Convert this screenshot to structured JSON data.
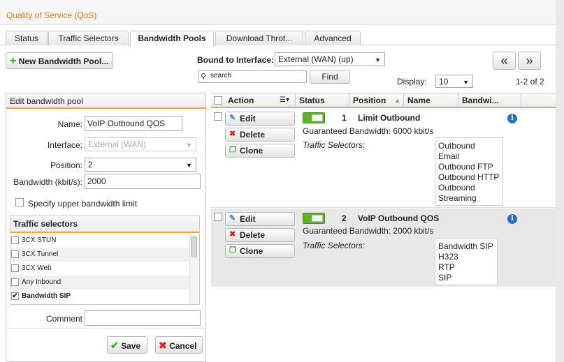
{
  "title": "Quality of Service (QoS)",
  "tabs": [
    {
      "label": "Status"
    },
    {
      "label": "Traffic Selectors"
    },
    {
      "label": "Bandwidth Pools"
    },
    {
      "label": "Download Throt..."
    },
    {
      "label": "Advanced"
    }
  ],
  "toolbar": {
    "new_pool": "New Bandwidth Pool...",
    "bound_label": "Bound to Interface:",
    "bound_value": "External (WAN) (up)",
    "search_placeholder": "search",
    "find": "Find",
    "display_label": "Display:",
    "display_value": "10",
    "pager_prev": "«",
    "pager_next": "»",
    "count": "1-2 of 2"
  },
  "edit_panel": {
    "title": "Edit bandwidth pool",
    "name_label": "Name:",
    "name_value": "VoIP Outbound QOS",
    "interface_label": "Interface:",
    "interface_value": "External (WAN)",
    "position_label": "Position:",
    "position_value": "2",
    "bandwidth_label": "Bandwidth (kbit/s):",
    "bandwidth_value": "2000",
    "upper_limit_label": "Specify upper bandwidth limit",
    "traffic_selectors_title": "Traffic selectors",
    "selectors": [
      {
        "label": "3CX STUN",
        "checked": false
      },
      {
        "label": "3CX Tunnel",
        "checked": false
      },
      {
        "label": "3CX Web",
        "checked": false
      },
      {
        "label": "Any Inbound",
        "checked": false
      },
      {
        "label": "Bandwidth SIP",
        "checked": true
      }
    ],
    "comment_label": "Comment",
    "comment_value": "",
    "save": "Save",
    "cancel": "Cancel"
  },
  "grid": {
    "columns": [
      "Action",
      "Status",
      "Position",
      "Name",
      "Bandwi..."
    ],
    "actions": {
      "edit": "Edit",
      "delete": "Delete",
      "clone": "Clone"
    },
    "traffic_selectors_label": "Traffic Selectors:",
    "rows": [
      {
        "position": "1",
        "name": "Limit Outbound",
        "guaranteed": "Guaranteed Bandwidth: 6000 kbit/s",
        "selectors": [
          "Outbound",
          "Email",
          "Outbound FTP",
          "Outbound HTTP",
          "Outbound",
          "Streaming"
        ],
        "enabled": true
      },
      {
        "position": "2",
        "name": "VoIP Outbound QOS",
        "guaranteed": "Guaranteed Bandwidth: 2000 kbit/s",
        "selectors": [
          "Bandwidth SIP",
          "H323",
          "RTP",
          "SIP"
        ],
        "enabled": true
      }
    ]
  },
  "colors": {
    "accent": "#e8770f",
    "toggle_on": "#5ab52a",
    "info": "#2a6fc2"
  }
}
